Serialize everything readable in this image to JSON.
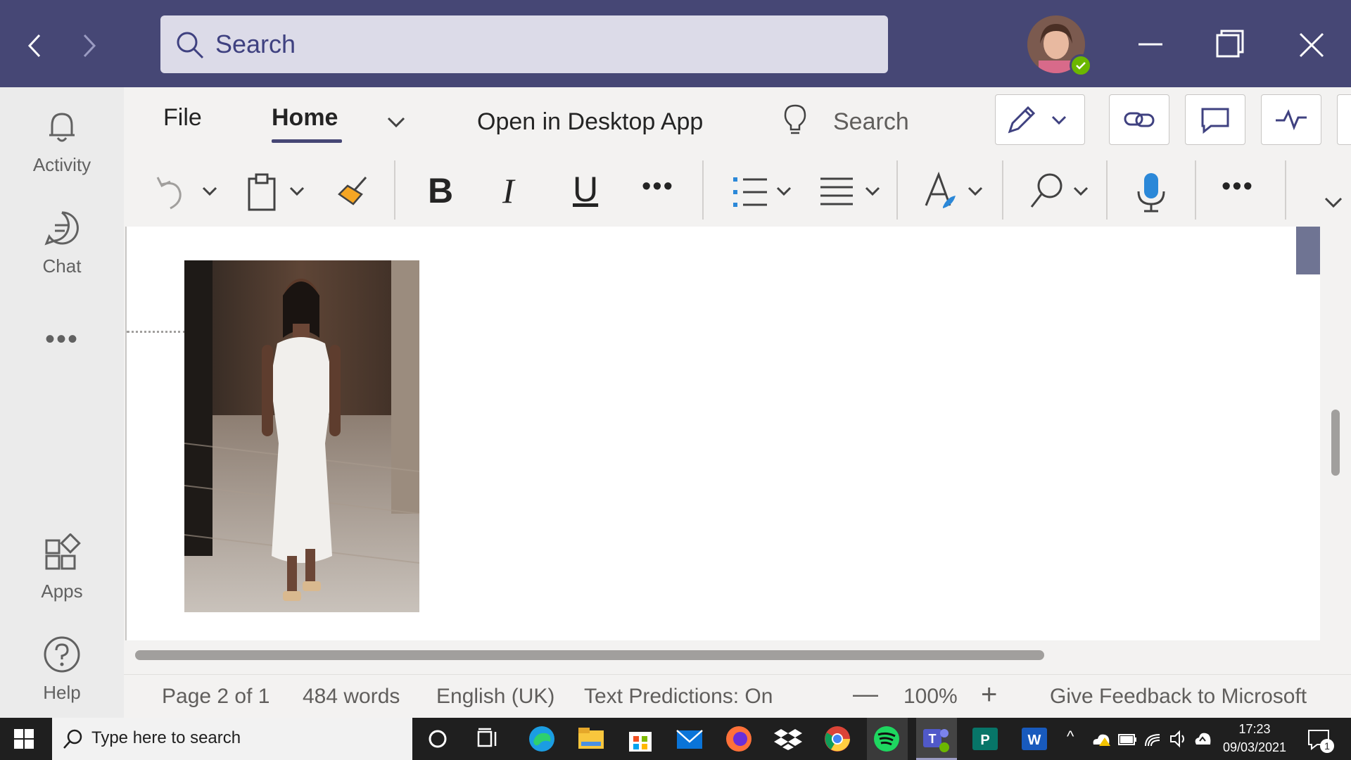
{
  "titlebar": {
    "search_placeholder": "Search",
    "avatar_alt": "profile-avatar"
  },
  "rail": {
    "activity": "Activity",
    "chat": "Chat",
    "apps": "Apps",
    "help": "Help"
  },
  "ribbon": {
    "tabs": {
      "file": "File",
      "home": "Home",
      "open_desktop": "Open in Desktop App",
      "search": "Search"
    }
  },
  "statusbar": {
    "page": "Page 2 of 1",
    "words": "484 words",
    "language": "English (UK)",
    "predictions": "Text Predictions: On",
    "zoom": "100%",
    "feedback": "Give Feedback to Microsoft"
  },
  "taskbar": {
    "search_placeholder": "Type here to search",
    "time": "17:23",
    "date": "09/03/2021",
    "notification_count": "1"
  },
  "colors": {
    "titlebar": "#464775",
    "accent": "#464775",
    "home_underline": "#464775",
    "teams_purple": "#464775"
  }
}
